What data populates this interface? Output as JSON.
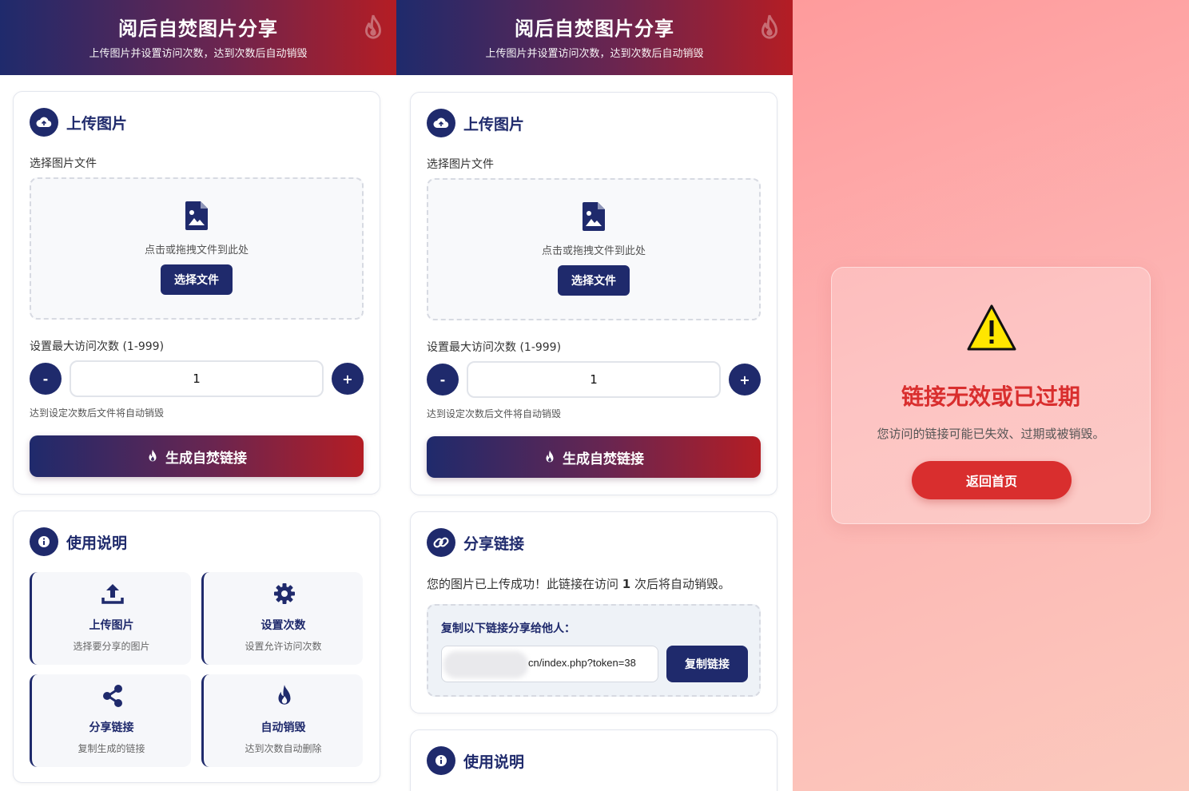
{
  "header": {
    "title": "阅后自焚图片分享",
    "subtitle": "上传图片并设置访问次数，达到次数后自动销毁"
  },
  "upload_card": {
    "title": "上传图片",
    "file_label": "选择图片文件",
    "drop_text": "点击或拖拽文件到此处",
    "choose_button": "选择文件",
    "count_label": "设置最大访问次数 (1-999)",
    "minus_label": "-",
    "plus_label": "+",
    "count_value": "1",
    "hint": "达到设定次数后文件将自动销毁",
    "generate_button": "生成自焚链接"
  },
  "usage_card": {
    "title": "使用说明",
    "tiles": [
      {
        "icon": "upload-icon",
        "title": "上传图片",
        "desc": "选择要分享的图片"
      },
      {
        "icon": "gear-icon",
        "title": "设置次数",
        "desc": "设置允许访问次数"
      },
      {
        "icon": "share-icon",
        "title": "分享链接",
        "desc": "复制生成的链接"
      },
      {
        "icon": "fire-icon",
        "title": "自动销毁",
        "desc": "达到次数自动删除"
      }
    ]
  },
  "share_card": {
    "title": "分享链接",
    "message_prefix": "您的图片已上传成功！此链接在访问",
    "message_count": "1",
    "message_suffix": "次后将自动销毁。",
    "copy_label": "复制以下链接分享给他人：",
    "url_visible": "cn/index.php?token=38",
    "copy_button": "复制链接"
  },
  "error_page": {
    "title": "链接无效或已过期",
    "message": "您访问的链接可能已失效、过期或被销毁。",
    "home_button": "返回首页"
  },
  "colors": {
    "navy": "#1f2a6c",
    "red": "#b41d24",
    "error_red": "#d92e2e",
    "error_bg": "#fdb3b2"
  }
}
